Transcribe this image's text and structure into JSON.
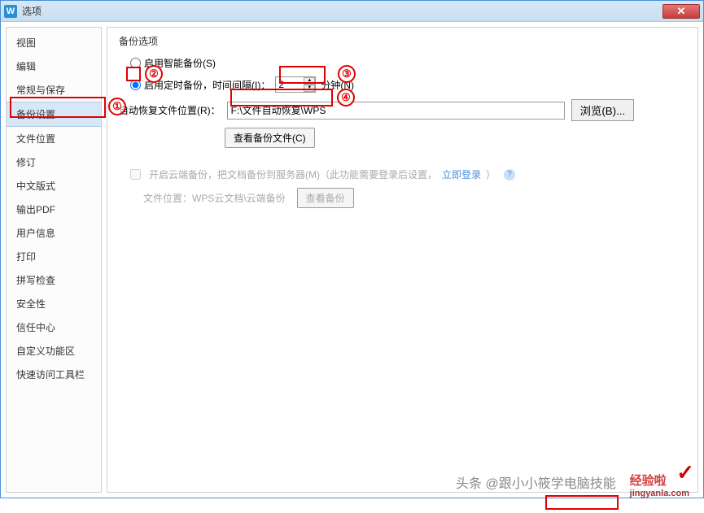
{
  "title": "选项",
  "sidebar": {
    "items": [
      {
        "label": "视图"
      },
      {
        "label": "编辑"
      },
      {
        "label": "常规与保存"
      },
      {
        "label": "备份设置"
      },
      {
        "label": "文件位置"
      },
      {
        "label": "修订"
      },
      {
        "label": "中文版式"
      },
      {
        "label": "输出PDF"
      },
      {
        "label": "用户信息"
      },
      {
        "label": "打印"
      },
      {
        "label": "拼写检查"
      },
      {
        "label": "安全性"
      },
      {
        "label": "信任中心"
      },
      {
        "label": "自定义功能区"
      },
      {
        "label": "快速访问工具栏"
      }
    ],
    "selected_index": 3
  },
  "content": {
    "section_title": "备份选项",
    "smart_backup": "启用智能备份(S)",
    "timed_backup_prefix": "启用定时备份，时间间隔(I)：",
    "interval_value": "2",
    "unit_label": "分钟(N)",
    "recover_path_label": "自动恢复文件位置(R)：",
    "recover_path_value": "F:\\文件自动恢复\\WPS",
    "browse_btn": "浏览(B)...",
    "view_backup_btn": "查看备份文件(C)",
    "cloud_checkbox": "开启云端备份，把文档备份到服务器(M)（此功能需要登录后设置，",
    "login_link": "立即登录",
    "cloud_tail": "）",
    "cloud_path_label": "文件位置：WPS云文档\\云端备份",
    "cloud_view_btn": "查看备份"
  },
  "annotations": {
    "num1": "①",
    "num2": "②",
    "num3": "③",
    "num4": "④"
  },
  "watermark": {
    "toutiao": "头条 @跟小小筱学电脑技能",
    "jy_main": "经验啦",
    "jy_sub": "jingyanla.com"
  }
}
